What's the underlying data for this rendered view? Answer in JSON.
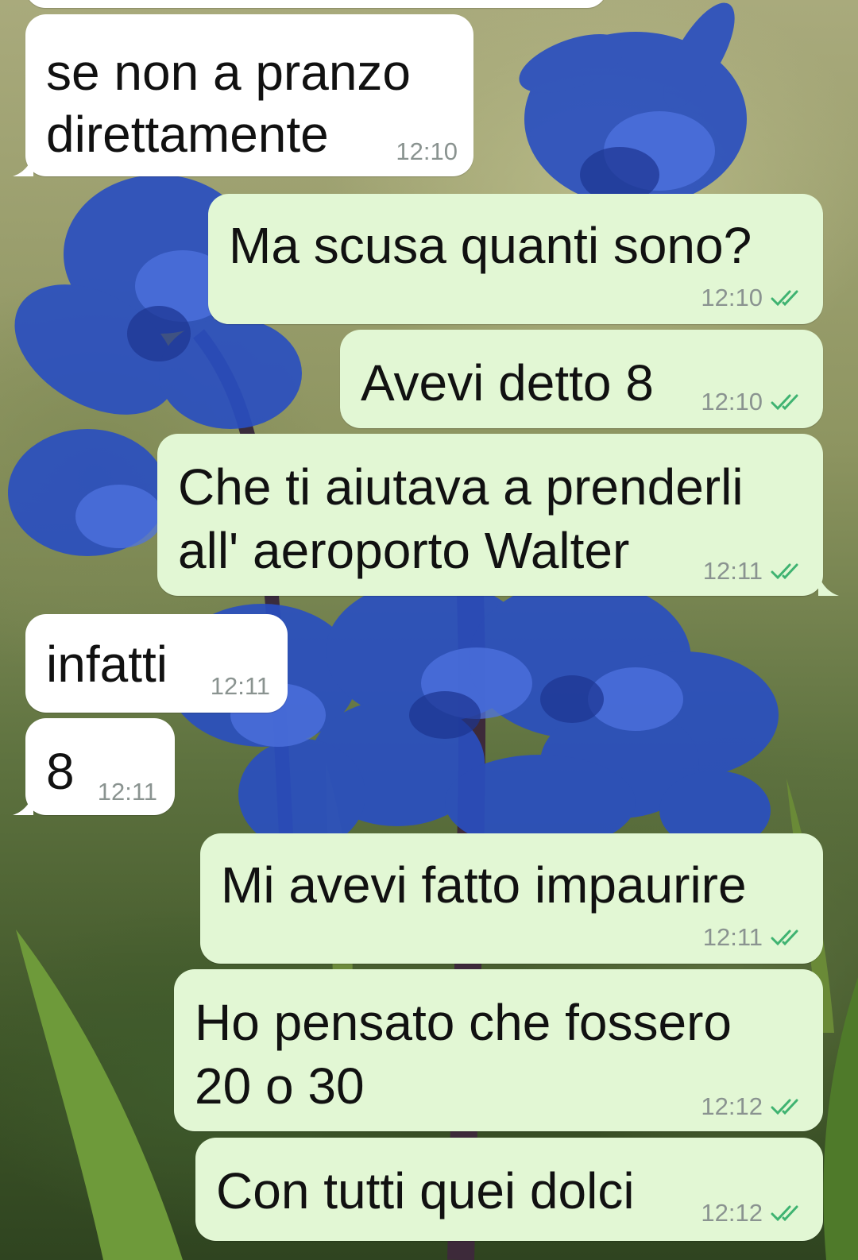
{
  "colors": {
    "incoming_bubble": "#ffffff",
    "outgoing_bubble": "#e2f7d4",
    "read_ticks": "#3fb371",
    "timestamp": "#8a9390",
    "text": "#111111"
  },
  "icons": {
    "read_receipt": "double-check-icon",
    "wallpaper": "blue-hyacinth-flowers"
  },
  "messages": [
    {
      "direction": "incoming",
      "lines": [
        "se non a pranzo",
        "direttamente"
      ],
      "time": "12:10"
    },
    {
      "direction": "outgoing",
      "lines": [
        "Ma scusa quanti sono?"
      ],
      "time": "12:10",
      "read": true
    },
    {
      "direction": "outgoing",
      "lines": [
        "Avevi detto 8"
      ],
      "time": "12:10",
      "read": true
    },
    {
      "direction": "outgoing",
      "lines": [
        "Che ti aiutava a prenderli",
        "all' aeroporto Walter"
      ],
      "time": "12:11",
      "read": true
    },
    {
      "direction": "incoming",
      "lines": [
        "infatti"
      ],
      "time": "12:11"
    },
    {
      "direction": "incoming",
      "lines": [
        "8"
      ],
      "time": "12:11"
    },
    {
      "direction": "outgoing",
      "lines": [
        "Mi avevi fatto impaurire"
      ],
      "time": "12:11",
      "read": true
    },
    {
      "direction": "outgoing",
      "lines": [
        "Ho pensato che fossero",
        "20 o 30"
      ],
      "time": "12:12",
      "read": true
    },
    {
      "direction": "outgoing",
      "lines": [
        "Con tutti quei dolci"
      ],
      "time": "12:12",
      "read": true
    }
  ]
}
